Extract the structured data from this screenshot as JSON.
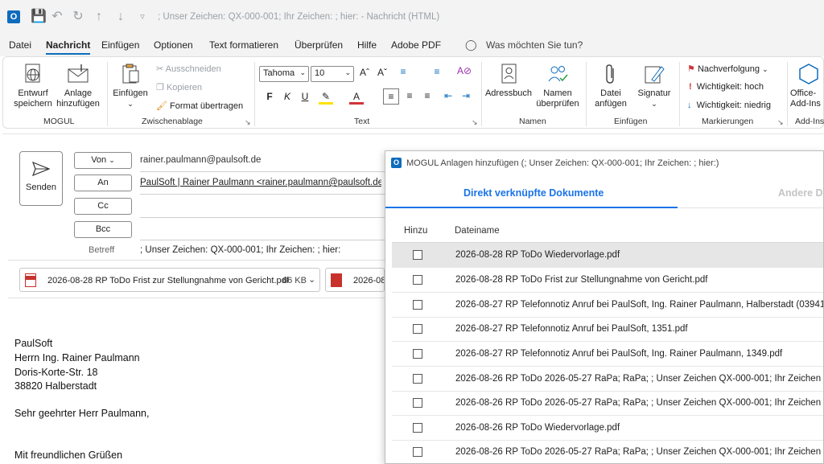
{
  "titlebar": {
    "title": "; Unser Zeichen: QX-000-001; Ihr Zeichen:  ; hier:  -  Nachricht (HTML)"
  },
  "menu": {
    "tabs": [
      "Datei",
      "Nachricht",
      "Einfügen",
      "Optionen",
      "Text formatieren",
      "Überprüfen",
      "Hilfe",
      "Adobe PDF"
    ],
    "search_hint": "Was möchten Sie tun?"
  },
  "ribbon": {
    "mogul": {
      "draft": "Entwurf\nspeichern",
      "attach": "Anlage\nhinzufügen",
      "label": "MOGUL"
    },
    "clipboard": {
      "paste": "Einfügen",
      "cut": "Ausschneiden",
      "copy": "Kopieren",
      "format_painter": "Format übertragen",
      "label": "Zwischenablage"
    },
    "text": {
      "font": "Tahoma",
      "size": "10",
      "label": "Text"
    },
    "names": {
      "addressbook": "Adressbuch",
      "check": "Namen\nüberprüfen",
      "label": "Namen"
    },
    "include": {
      "file": "Datei\nanfügen",
      "signature": "Signatur",
      "label": "Einfügen"
    },
    "tags": {
      "followup": "Nachverfolgung",
      "high": "Wichtigkeit: hoch",
      "low": "Wichtigkeit: niedrig",
      "label": "Markierungen"
    },
    "addins": {
      "office": "Office-\nAdd-Ins",
      "label": "Add-Ins"
    }
  },
  "compose": {
    "send": "Senden",
    "from_btn": "Von",
    "to_btn": "An",
    "cc_btn": "Cc",
    "bcc_btn": "Bcc",
    "from_value": "rainer.paulmann@paulsoft.de",
    "to_value": "PaulSoft | Rainer Paulmann <rainer.paulmann@paulsoft.de>;",
    "subject_label": "Betreff",
    "subject_value": "; Unser Zeichen: QX-000-001; Ihr Zeichen:  ; hier:",
    "attachments": [
      {
        "name": "2026-08-28 RP ToDo Frist zur Stellungnahme von Gericht.pdf",
        "size": "66 KB"
      },
      {
        "name": "2026-08-",
        "size": ""
      }
    ],
    "body": [
      "PaulSoft",
      "Herrn Ing. Rainer Paulmann",
      "Doris-Korte-Str. 18",
      "38820 Halberstadt",
      "Sehr geehrter Herr Paulmann,",
      "Mit freundlichen Grüßen"
    ]
  },
  "dialog": {
    "title": "MOGUL Anlagen hinzufügen (; Unser Zeichen: QX-000-001; Ihr Zeichen:  ; hier:)",
    "tab_active": "Direkt verknüpfte Dokumente",
    "tab_inactive": "Andere Do",
    "col_add": "Hinzu",
    "col_name": "Dateiname",
    "rows": [
      "2026-08-28 RP ToDo Wiedervorlage.pdf",
      "2026-08-28 RP ToDo Frist zur Stellungnahme von Gericht.pdf",
      "2026-08-27 RP Telefonnotiz Anruf bei PaulSoft, Ing. Rainer Paulmann, Halberstadt (03941",
      "2026-08-27 RP Telefonnotiz Anruf bei PaulSoft, 1351.pdf",
      "2026-08-27 RP Telefonnotiz Anruf bei PaulSoft, Ing. Rainer Paulmann, 1349.pdf",
      "2026-08-26 RP ToDo 2026-05-27 RaPa; RaPa; ; Unser Zeichen QX-000-001; Ihr Zeichen ; hi",
      "2026-08-26 RP ToDo 2026-05-27 RaPa; RaPa; ; Unser Zeichen QX-000-001; Ihr Zeichen ; hi",
      "2026-08-26 RP ToDo Wiedervorlage.pdf",
      "2026-08-26 RP ToDo 2026-05-27 RaPa; RaPa; ; Unser Zeichen QX-000-001; Ihr Zeichen ; hi"
    ]
  }
}
